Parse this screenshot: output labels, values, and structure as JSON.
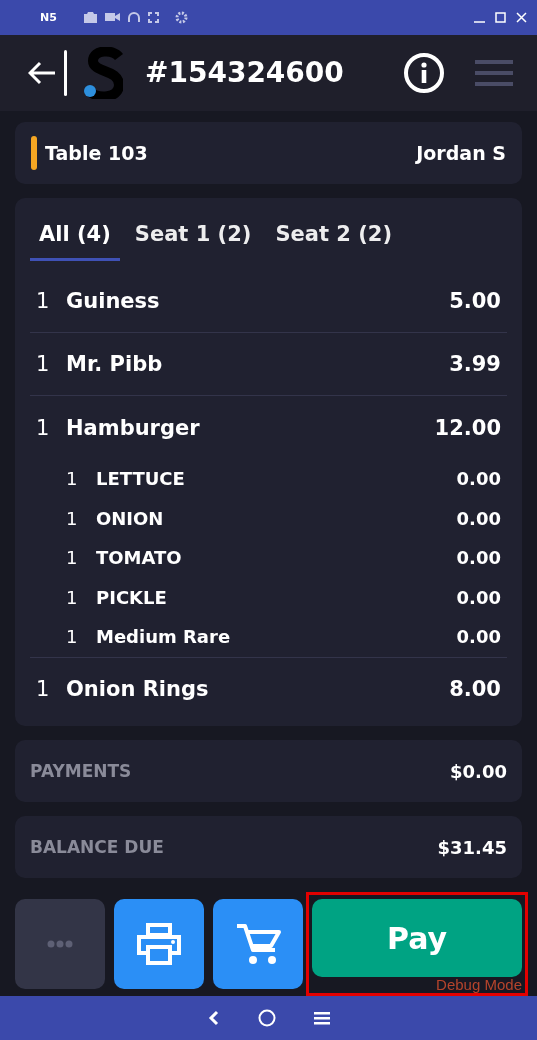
{
  "emulator_bar": {
    "title": "N5"
  },
  "header": {
    "order_number": "#154324600"
  },
  "table": {
    "name": "Table 103",
    "server": "Jordan S",
    "color": "#f5a623"
  },
  "tabs": [
    {
      "label": "All (4)",
      "selected": true
    },
    {
      "label": "Seat 1 (2)",
      "selected": false
    },
    {
      "label": "Seat 2 (2)",
      "selected": false
    }
  ],
  "items": [
    {
      "qty": "1",
      "name": "Guiness",
      "price": "5.00"
    },
    {
      "qty": "1",
      "name": "Mr. Pibb",
      "price": "3.99"
    },
    {
      "qty": "1",
      "name": "Hamburger",
      "price": "12.00",
      "children": [
        {
          "qty": "1",
          "name": "LETTUCE",
          "price": "0.00"
        },
        {
          "qty": "1",
          "name": "ONION",
          "price": "0.00"
        },
        {
          "qty": "1",
          "name": "TOMATO",
          "price": "0.00"
        },
        {
          "qty": "1",
          "name": "PICKLE",
          "price": "0.00"
        },
        {
          "qty": "1",
          "name": "Medium Rare",
          "price": "0.00"
        }
      ]
    },
    {
      "qty": "1",
      "name": "Onion Rings",
      "price": "8.00"
    }
  ],
  "totals": [
    {
      "label": "PAYMENTS",
      "value": "$0.00"
    },
    {
      "label": "BALANCE DUE",
      "value": "$31.45"
    }
  ],
  "actions": [
    {
      "kind": "more",
      "disabled": true
    },
    {
      "kind": "print",
      "disabled": false
    },
    {
      "kind": "cart",
      "disabled": false
    }
  ],
  "pay_button": {
    "label": "Pay"
  },
  "debug_label": "Debug Mode"
}
